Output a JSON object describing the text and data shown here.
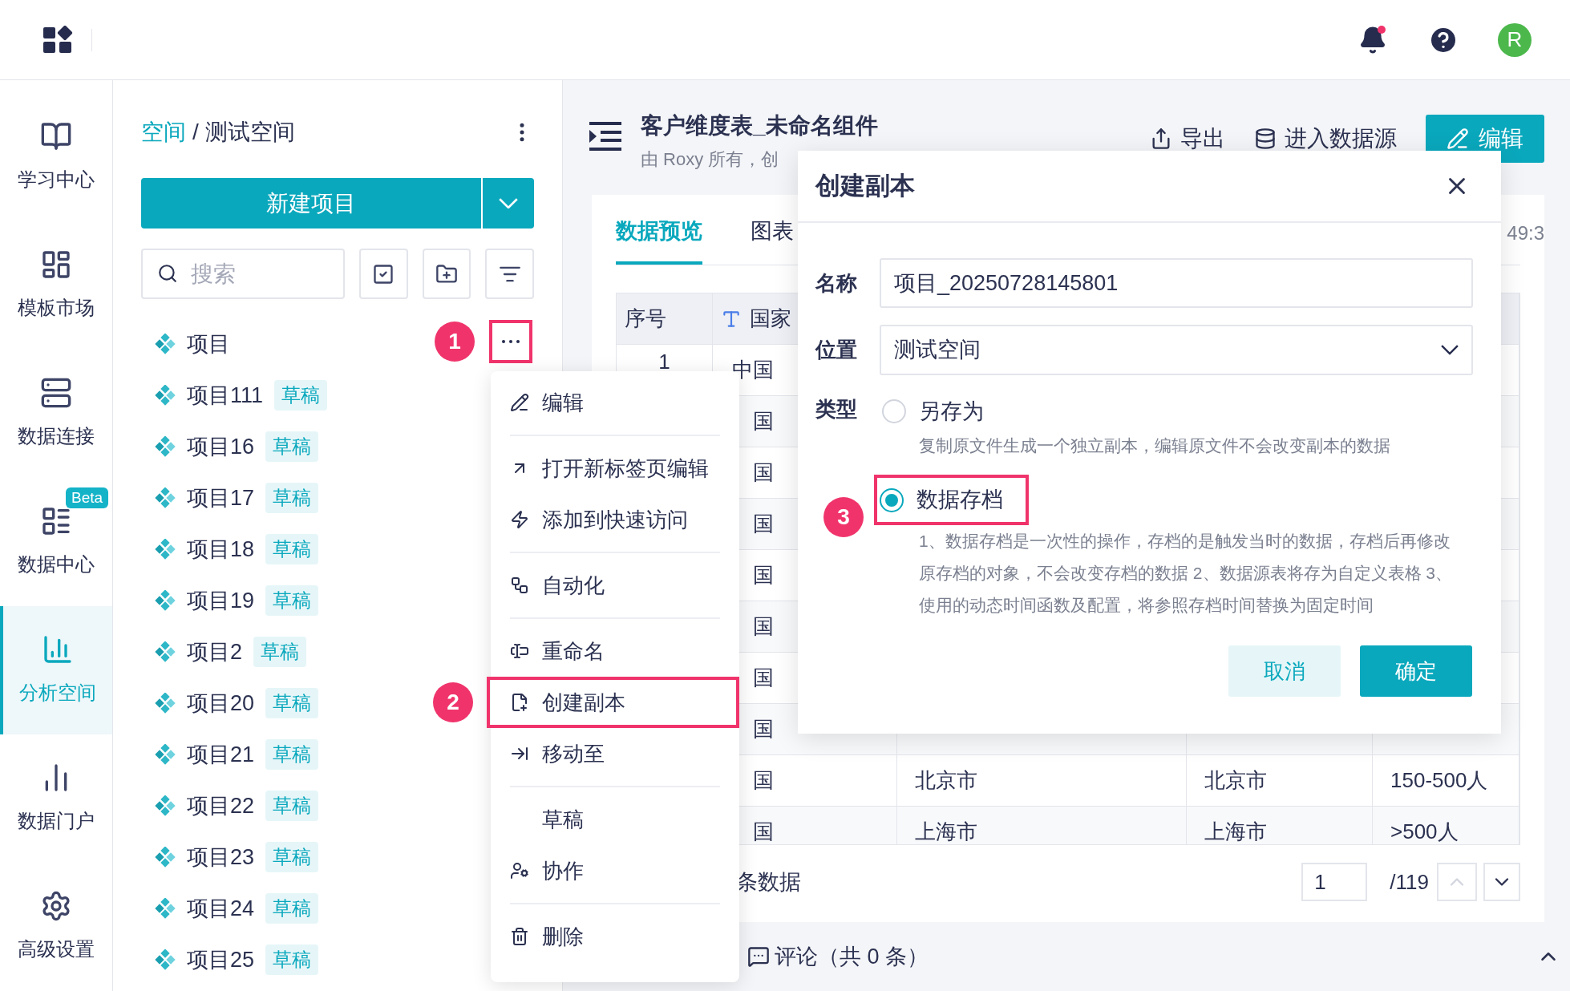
{
  "top_bar": {
    "notification_dot": true,
    "avatar": "R"
  },
  "nav": [
    {
      "label": "学习中心",
      "selected": false
    },
    {
      "label": "模板市场",
      "selected": false
    },
    {
      "label": "数据连接",
      "selected": false
    },
    {
      "label": "数据中心",
      "selected": false,
      "badge": "Beta"
    },
    {
      "label": "分析空间",
      "selected": true
    },
    {
      "label": "数据门户",
      "selected": false
    },
    {
      "label": "高级设置",
      "selected": false
    }
  ],
  "project_panel": {
    "breadcrumb": {
      "root": "空间",
      "separator": "/",
      "current": "测试空间"
    },
    "new_button": "新建项目",
    "search": {
      "placeholder": "搜索"
    },
    "items": [
      {
        "name": "项目",
        "more_highlighted": true,
        "annotation": "1"
      },
      {
        "name": "项目111",
        "tag": "草稿"
      },
      {
        "name": "项目16",
        "tag": "草稿"
      },
      {
        "name": "项目17",
        "tag": "草稿"
      },
      {
        "name": "项目18",
        "tag": "草稿"
      },
      {
        "name": "项目19",
        "tag": "草稿"
      },
      {
        "name": "项目2",
        "tag": "草稿"
      },
      {
        "name": "项目20",
        "tag": "草稿"
      },
      {
        "name": "项目21",
        "tag": "草稿"
      },
      {
        "name": "项目22",
        "tag": "草稿"
      },
      {
        "name": "项目23",
        "tag": "草稿"
      },
      {
        "name": "项目24",
        "tag": "草稿"
      },
      {
        "name": "项目25",
        "tag": "草稿"
      }
    ]
  },
  "context_menu": {
    "items": [
      {
        "kind": "item",
        "label": "编辑"
      },
      {
        "kind": "divider"
      },
      {
        "kind": "item",
        "label": "打开新标签页编辑"
      },
      {
        "kind": "item",
        "label": "添加到快速访问"
      },
      {
        "kind": "divider"
      },
      {
        "kind": "item",
        "label": "自动化"
      },
      {
        "kind": "divider"
      },
      {
        "kind": "item",
        "label": "重命名"
      },
      {
        "kind": "item",
        "label": "创建副本",
        "highlighted": true,
        "annotation": "2"
      },
      {
        "kind": "item",
        "label": "移动至"
      },
      {
        "kind": "divider"
      },
      {
        "kind": "text",
        "label": "草稿"
      },
      {
        "kind": "item",
        "label": "协作"
      },
      {
        "kind": "divider"
      },
      {
        "kind": "item",
        "label": "删除"
      }
    ]
  },
  "main": {
    "title": "客户维度表_未命名组件",
    "subtitle": "由 Roxy 所有，创",
    "actions": [
      "导出",
      "进入数据源"
    ],
    "edit_button": "编辑",
    "tabs": [
      {
        "label": "数据预览",
        "selected": true
      },
      {
        "label": "图表",
        "selected": false
      }
    ],
    "time_fragment": "49:3",
    "table": {
      "columns": [
        "序号",
        "国家"
      ],
      "rows": [
        {
          "index": "1",
          "country": "中国"
        },
        {
          "country": "国"
        },
        {
          "country": "国"
        },
        {
          "country": "国"
        },
        {
          "country": "国"
        },
        {
          "country": "国"
        },
        {
          "country": "国"
        },
        {
          "country": "国"
        },
        {
          "country": "国",
          "column_3": "北京市",
          "column_4": "北京市",
          "column_5": "150-500人"
        },
        {
          "country": "国",
          "column_3": "上海市",
          "column_4": "上海市",
          "column_5": ">500人"
        }
      ]
    },
    "pagination": {
      "summary": "条数据",
      "page": "1",
      "total": "/119",
      "prev_disabled": true
    },
    "footer": {
      "comments": "评论（共 0 条）"
    }
  },
  "dialog": {
    "title": "创建副本",
    "name_label": "名称",
    "name_value": "项目_20250728145801",
    "location_label": "位置",
    "location_value": "测试空间",
    "type_label": "类型",
    "type_options": [
      {
        "label": "另存为",
        "selected": false,
        "description": "复制原文件生成一个独立副本，编辑原文件不会改变副本的数据"
      },
      {
        "label": "数据存档",
        "selected": true,
        "annotation": "3",
        "description": "1、数据存档是一次性的操作，存档的是触发当时的数据，存档后再修改原存档的对象，不会改变存档的数据 2、数据源表将存为自定义表格 3、使用的动态时间函数及配置，将参照存档时间替换为固定时间"
      }
    ],
    "cancel": "取消",
    "confirm": "确定"
  }
}
